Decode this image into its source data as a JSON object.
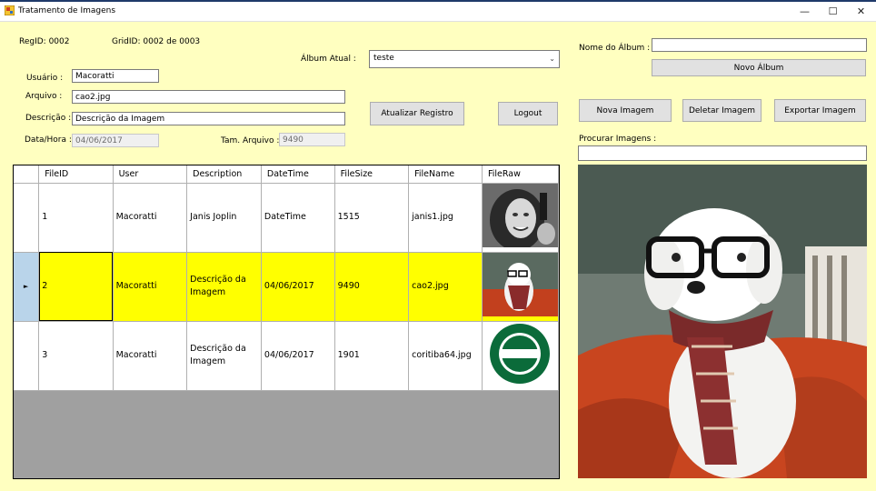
{
  "window": {
    "title": "Tratamento de Imagens",
    "minimize": "—",
    "maximize": "☐",
    "close": "✕"
  },
  "info": {
    "regid": "RegID: 0002",
    "gridid": "GridID: 0002 de 0003"
  },
  "form": {
    "usuario_label": "Usuário :",
    "usuario_value": "Macoratti",
    "arquivo_label": "Arquivo :",
    "arquivo_value": "cao2.jpg",
    "descricao_label": "Descrição :",
    "descricao_value": "Descrição da Imagem",
    "datahora_label": "Data/Hora :",
    "datahora_value": "04/06/2017",
    "tam_label": "Tam. Arquivo :",
    "tam_value": "9490",
    "album_label": "Álbum Atual :",
    "album_value": "teste"
  },
  "buttons": {
    "atualizar": "Atualizar Registro",
    "logout": "Logout",
    "novo_album": "Novo Álbum",
    "nova_imagem": "Nova Imagem",
    "deletar_imagem": "Deletar Imagem",
    "exportar_imagem": "Exportar Imagem"
  },
  "right": {
    "nome_album_label": "Nome do Álbum :",
    "nome_album_value": "",
    "procurar_label": "Procurar Imagens :",
    "procurar_value": ""
  },
  "grid": {
    "columns": [
      "FileID",
      "User",
      "Description",
      "DateTime",
      "FileSize",
      "FileName",
      "FileRaw"
    ],
    "rows": [
      {
        "fileid": "1",
        "user": "Macoratti",
        "description": "Janis Joplin",
        "datetime": "DateTime",
        "filesize": "1515",
        "filename": "janis1.jpg",
        "fileraw": "janis-photo"
      },
      {
        "fileid": "2",
        "user": "Macoratti",
        "description": "Descrição da Imagem",
        "datetime": "04/06/2017",
        "filesize": "9490",
        "filename": "cao2.jpg",
        "fileraw": "dog-photo",
        "selected": true
      },
      {
        "fileid": "3",
        "user": "Macoratti",
        "description": "Descrição da Imagem",
        "datetime": "04/06/2017",
        "filesize": "1901",
        "filename": "coritiba64.jpg",
        "fileraw": "cfc-logo"
      }
    ],
    "row_indicator": "►"
  },
  "colors": {
    "background": "#ffffc0",
    "selection": "#ffff00",
    "rowheader_selected": "#b9d4ea"
  }
}
